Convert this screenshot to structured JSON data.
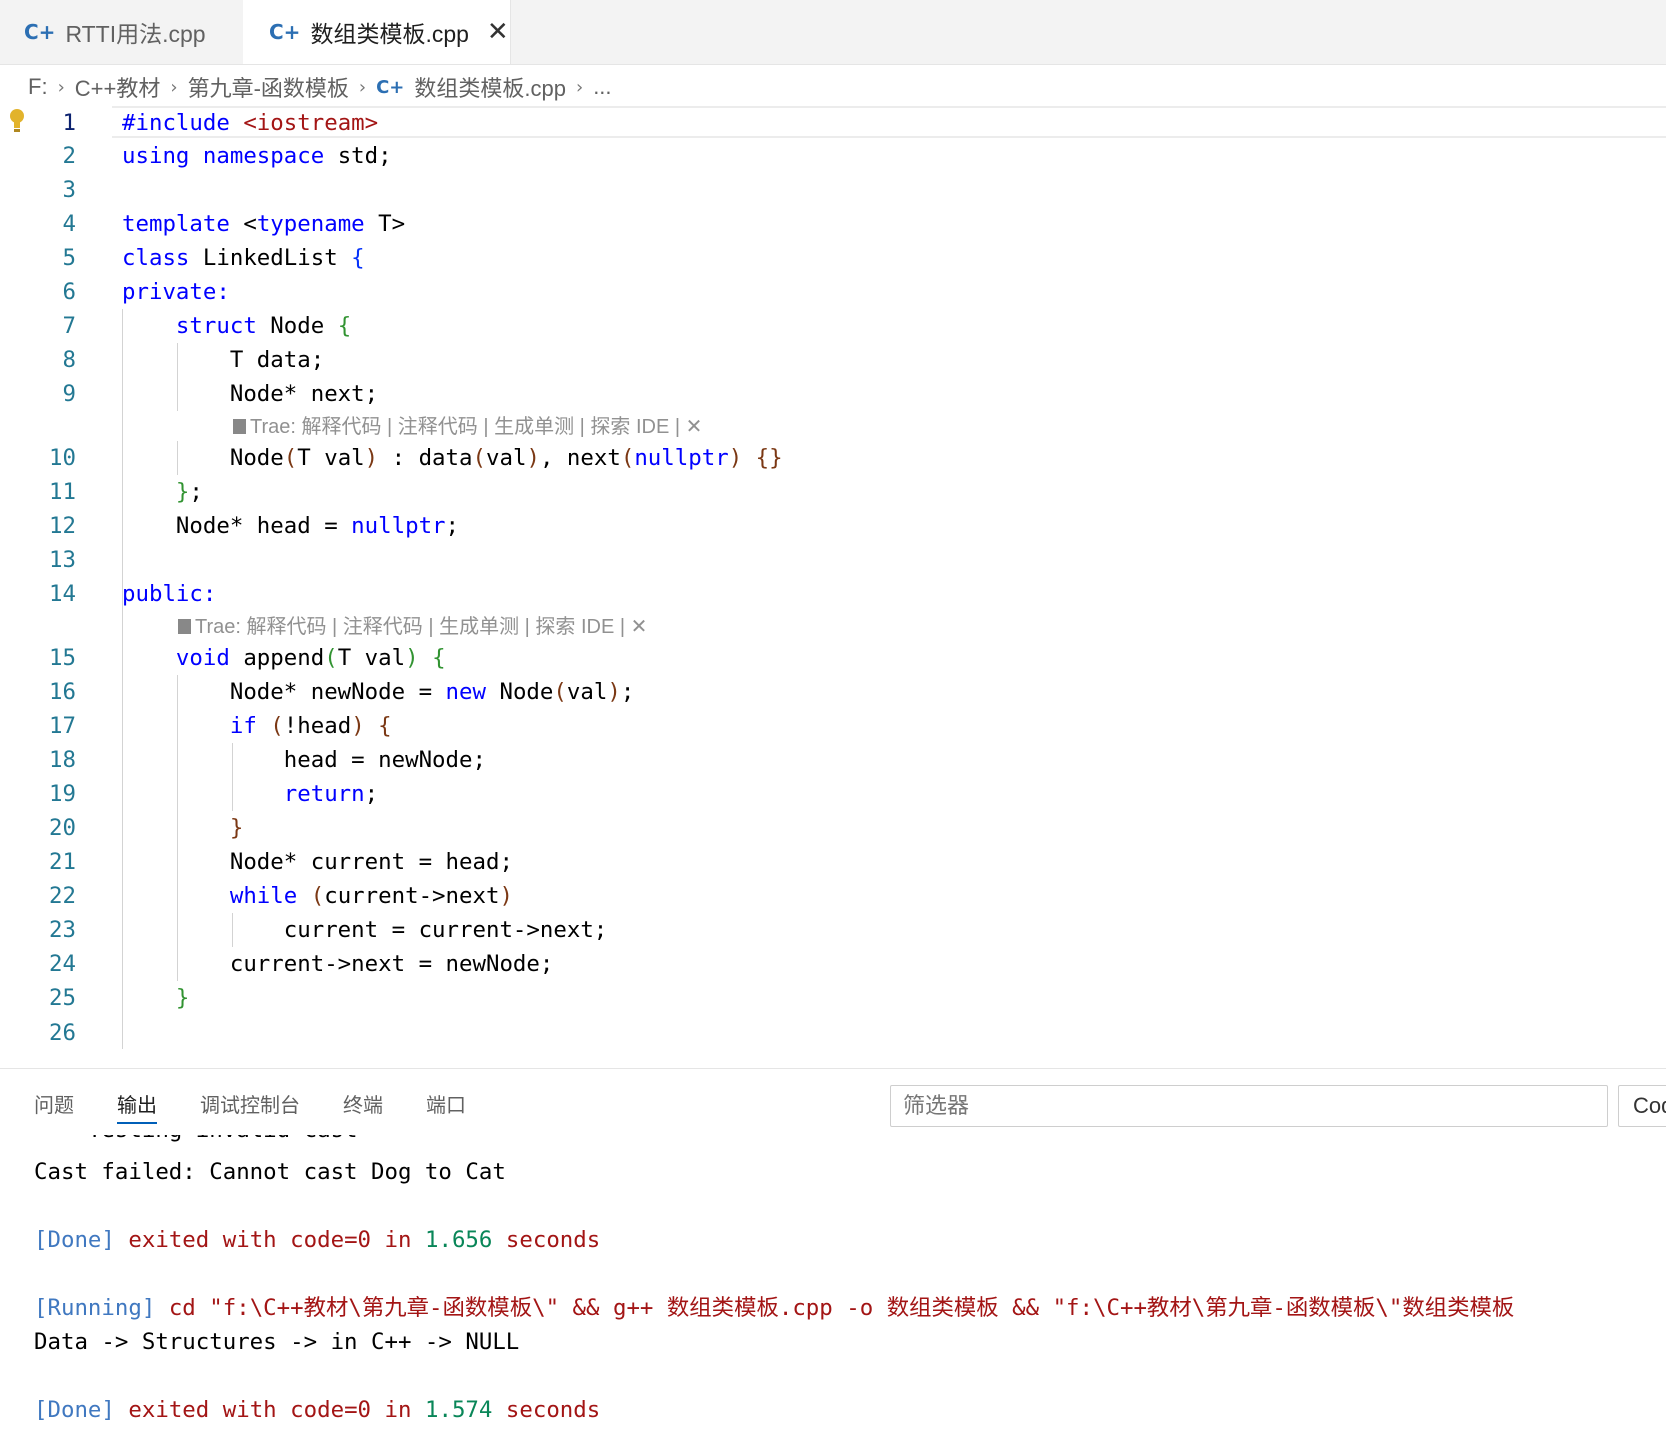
{
  "tabs": [
    {
      "icon": "C+",
      "label": "RTTI用法.cpp",
      "active": false
    },
    {
      "icon": "C+",
      "label": "数组类模板.cpp",
      "active": true,
      "close": "✕"
    }
  ],
  "breadcrumb": [
    "F:",
    "C++教材",
    "第九章-函数模板",
    "数组类模板.cpp",
    "..."
  ],
  "editor": {
    "line_numbers": [
      "1",
      "2",
      "3",
      "4",
      "5",
      "6",
      "7",
      "8",
      "9",
      "10",
      "11",
      "12",
      "13",
      "14",
      "15",
      "16",
      "17",
      "18",
      "19",
      "20",
      "21",
      "22",
      "23",
      "24",
      "25",
      "26"
    ],
    "codelens": {
      "prefix": "Trae: ",
      "items": "解释代码 | 注释代码 | 生成单测 | 探索 IDE | ",
      "close": "✕"
    }
  },
  "panel": {
    "tabs": [
      "问题",
      "输出",
      "调试控制台",
      "终端",
      "端口"
    ],
    "active_tab": "输出",
    "filter_placeholder": "筛选器",
    "code_button": "Code"
  },
  "output": {
    "clipped_line": "--- Testing invalid cast ---",
    "line1": "Cast failed: Cannot cast Dog to Cat",
    "done1": {
      "tag": "[Done]",
      "exited": "exited with",
      "code": "code=0",
      "in": "in",
      "time": "1.656",
      "unit": "seconds"
    },
    "running": {
      "tag": "[Running]",
      "cmd": "cd \"f:\\C++教材\\第九章-函数模板\\\" && g++ 数组类模板.cpp -o 数组类模板 && \"f:\\C++教材\\第九章-函数模板\\\"数组类模板"
    },
    "line2": "Data -> Structures -> in C++ -> NULL",
    "done2": {
      "tag": "[Done]",
      "exited": "exited with",
      "code": "code=0",
      "in": "in",
      "time": "1.574",
      "unit": "seconds"
    }
  },
  "colors": {
    "keyword": "#0000ff",
    "string": "#a31515",
    "line_number": "#237893",
    "accent": "#005fb8"
  }
}
